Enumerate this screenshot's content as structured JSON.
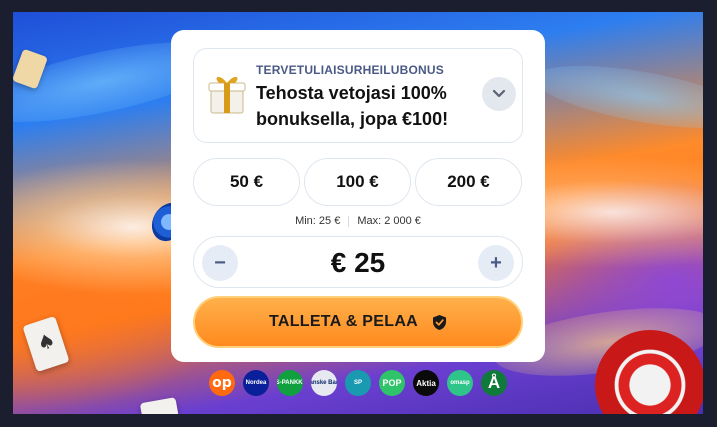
{
  "bonus": {
    "kicker": "TERVETULIAISURHEILUBONUS",
    "title": "Tehosta vetojasi 100% bonuksella, jopa €100!"
  },
  "amounts": [
    {
      "label": "50 €"
    },
    {
      "label": "100 €"
    },
    {
      "label": "200 €"
    }
  ],
  "limits": {
    "min": "Min: 25 €",
    "max": "Max: 2 000 €"
  },
  "stake": {
    "minus": "−",
    "value": "€ 25",
    "plus": "+"
  },
  "deposit": {
    "label": "TALLETA & PELAA"
  },
  "banks": [
    {
      "name": "op-icon",
      "text": "op",
      "color": "#ff6a10"
    },
    {
      "name": "nordea-icon",
      "text": "Nordea",
      "color": "#0a1f9a"
    },
    {
      "name": "handelsbanken-icon",
      "text": "S-PANKKI",
      "color": "#10a040"
    },
    {
      "name": "danske-bank-icon",
      "text": "Danske Bank",
      "color": "#e6e9f2"
    },
    {
      "name": "saastopankki-icon",
      "text": "SP",
      "color": "#1a9ab0"
    },
    {
      "name": "pop-icon",
      "text": "POP",
      "color": "#2fc46a"
    },
    {
      "name": "aktia-icon",
      "text": "Aktia",
      "color": "#0a0a0a"
    },
    {
      "name": "omasp-icon",
      "text": "omasp",
      "color": "#2fc48a"
    },
    {
      "name": "alandsbanken-icon",
      "text": "Å",
      "color": "#0f7a3a"
    }
  ],
  "colors": {
    "accent_orange": "#ff8a1f",
    "kicker_blue": "#4a5a85",
    "panel_bg": "#ffffff"
  }
}
